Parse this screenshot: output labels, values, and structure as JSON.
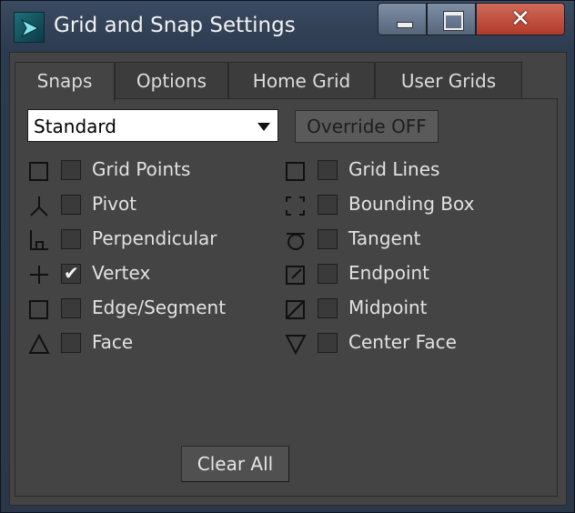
{
  "window": {
    "title": "Grid and Snap Settings"
  },
  "titlebar": {
    "minimize_icon": "minimize-icon",
    "maximize_icon": "maximize-icon",
    "close_label": "✕"
  },
  "tabs": [
    {
      "label": "Snaps",
      "active": true
    },
    {
      "label": "Options",
      "active": false
    },
    {
      "label": "Home Grid",
      "active": false
    },
    {
      "label": "User Grids",
      "active": false
    }
  ],
  "snap_set": {
    "selected": "Standard"
  },
  "override": {
    "label": "Override OFF"
  },
  "snaps_left": [
    {
      "label": "Grid Points",
      "checked": false,
      "icon": "grid-points-icon"
    },
    {
      "label": "Pivot",
      "checked": false,
      "icon": "pivot-icon"
    },
    {
      "label": "Perpendicular",
      "checked": false,
      "icon": "perpendicular-icon"
    },
    {
      "label": "Vertex",
      "checked": true,
      "icon": "vertex-icon"
    },
    {
      "label": "Edge/Segment",
      "checked": false,
      "icon": "edge-segment-icon"
    },
    {
      "label": "Face",
      "checked": false,
      "icon": "face-icon"
    }
  ],
  "snaps_right": [
    {
      "label": "Grid Lines",
      "checked": false,
      "icon": "grid-lines-icon"
    },
    {
      "label": "Bounding Box",
      "checked": false,
      "icon": "bounding-box-icon"
    },
    {
      "label": "Tangent",
      "checked": false,
      "icon": "tangent-icon"
    },
    {
      "label": "Endpoint",
      "checked": false,
      "icon": "endpoint-icon"
    },
    {
      "label": "Midpoint",
      "checked": false,
      "icon": "midpoint-icon"
    },
    {
      "label": "Center Face",
      "checked": false,
      "icon": "center-face-icon"
    }
  ],
  "clear_all": {
    "label": "Clear All"
  },
  "check_mark": "✔"
}
